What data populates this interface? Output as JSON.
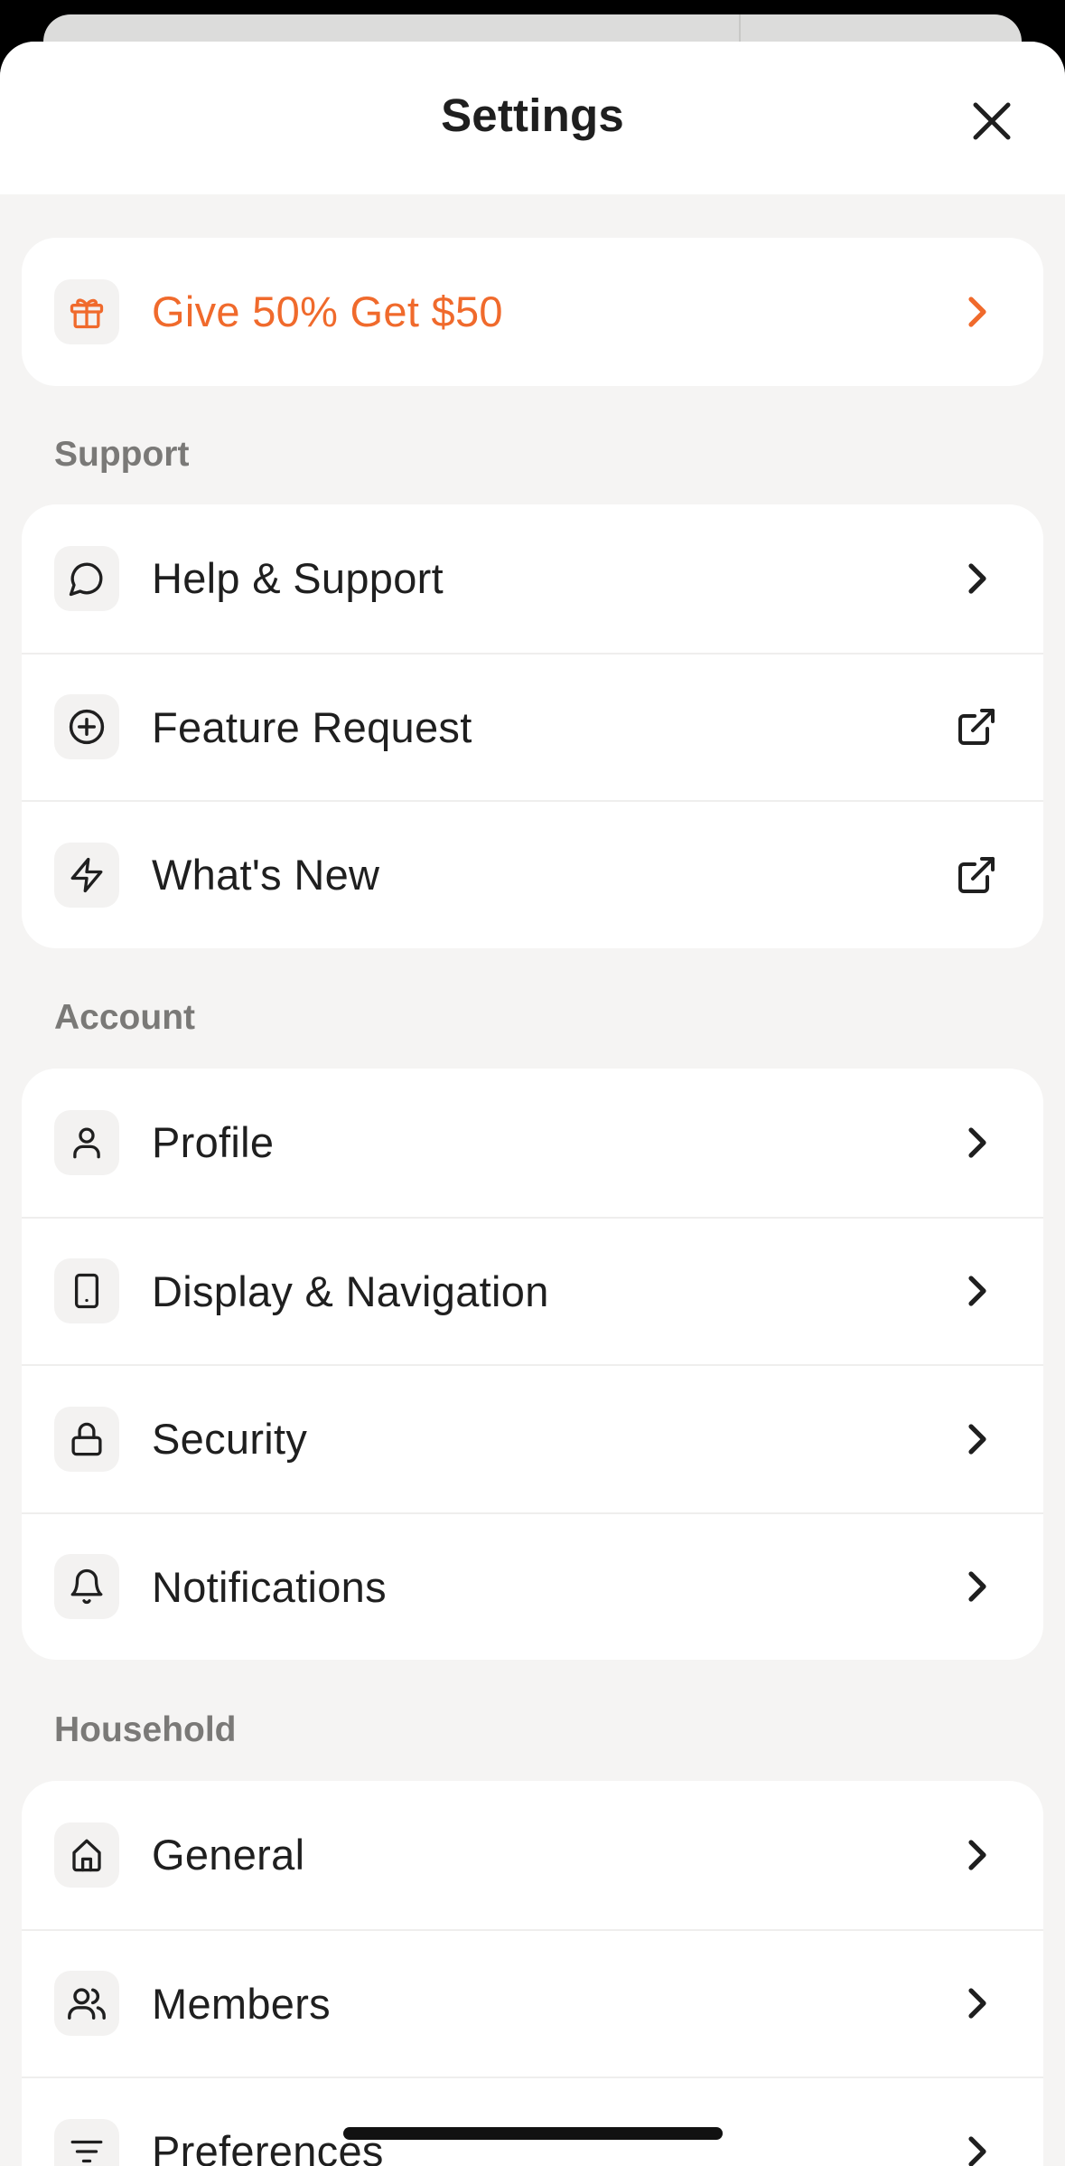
{
  "header": {
    "title": "Settings",
    "close_icon": "close-icon"
  },
  "promo": {
    "label": "Give 50% Get $50",
    "icon": "gift-icon",
    "accent": "#f06a2c"
  },
  "sections": {
    "support": {
      "label": "Support",
      "items": [
        {
          "label": "Help & Support",
          "icon": "chat-bubble-icon",
          "trail": "chevron-right-icon"
        },
        {
          "label": "Feature Request",
          "icon": "plus-circle-icon",
          "trail": "external-link-icon"
        },
        {
          "label": "What's New",
          "icon": "lightning-icon",
          "trail": "external-link-icon"
        }
      ]
    },
    "account": {
      "label": "Account",
      "items": [
        {
          "label": "Profile",
          "icon": "person-icon",
          "trail": "chevron-right-icon"
        },
        {
          "label": "Display & Navigation",
          "icon": "phone-icon",
          "trail": "chevron-right-icon"
        },
        {
          "label": "Security",
          "icon": "lock-icon",
          "trail": "chevron-right-icon"
        },
        {
          "label": "Notifications",
          "icon": "bell-icon",
          "trail": "chevron-right-icon"
        }
      ]
    },
    "household": {
      "label": "Household",
      "items": [
        {
          "label": "General",
          "icon": "house-icon",
          "trail": "chevron-right-icon"
        },
        {
          "label": "Members",
          "icon": "users-icon",
          "trail": "chevron-right-icon"
        },
        {
          "label": "Preferences",
          "icon": "filter-icon",
          "trail": "chevron-right-icon"
        }
      ]
    }
  }
}
